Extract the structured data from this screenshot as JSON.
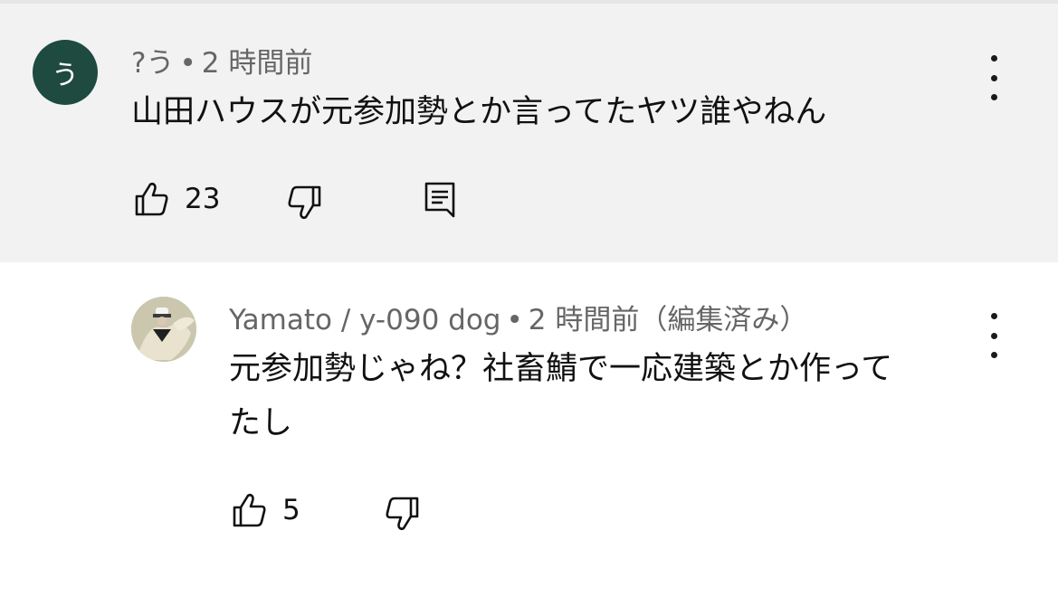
{
  "comments": [
    {
      "avatar_letter": "う",
      "author": "?う",
      "separator": "•",
      "time": "2 時間前",
      "text": "山田ハウスが元参加勢とか言ってたヤツ誰やねん",
      "likes": "23",
      "icons": {
        "like": "thumbs-up-icon",
        "dislike": "thumbs-down-icon",
        "reply": "reply-icon",
        "menu": "more-vert-icon"
      }
    },
    {
      "author": "Yamato / y-090 dog",
      "separator": "•",
      "time": "2 時間前（編集済み）",
      "text_line1": "元参加勢じゃね？社畜鯖で一応建築とか作って",
      "text_line2": "たし",
      "likes": "5",
      "icons": {
        "like": "thumbs-up-icon",
        "dislike": "thumbs-down-icon",
        "menu": "more-vert-icon"
      }
    }
  ],
  "colors": {
    "top_bg": "#f2f2f2",
    "avatar_green": "#1e4a3f",
    "meta_gray": "#666666"
  }
}
